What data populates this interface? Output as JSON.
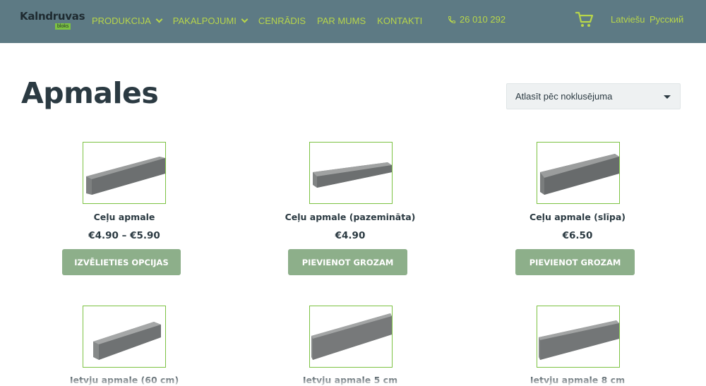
{
  "header": {
    "logo_text": "Kalndruvas",
    "logo_sub": "bloks",
    "nav": [
      {
        "label": "PRODUKCIJA",
        "dropdown": true
      },
      {
        "label": "PAKALPOJUMI",
        "dropdown": true
      },
      {
        "label": "CENRĀDIS",
        "dropdown": false
      },
      {
        "label": "PAR MUMS",
        "dropdown": false
      },
      {
        "label": "KONTAKTI",
        "dropdown": false
      }
    ],
    "phone": "26 010 292",
    "cart_icon": "cart-icon",
    "languages": [
      "Latviešu",
      "Русский"
    ]
  },
  "page": {
    "title": "Apmales",
    "sort_label": "Atlasīt pēc noklusējuma"
  },
  "products": [
    {
      "name": "Ceļu apmale",
      "price": "€4.90 – €5.90",
      "button": "IZVĒLIETIES OPCIJAS"
    },
    {
      "name": "Ceļu apmale (pazemināta)",
      "price": "€4.90",
      "button": "PIEVIENOT GROZAM"
    },
    {
      "name": "Ceļu apmale (slīpa)",
      "price": "€6.50",
      "button": "PIEVIENOT GROZAM"
    },
    {
      "name": "Ietvju apmale (60 cm)"
    },
    {
      "name": "Ietvju apmale 5 cm"
    },
    {
      "name": "Ietvju apmale 8 cm"
    }
  ],
  "colors": {
    "header_bg": "#5d7a84",
    "accent": "#b8d64a",
    "button_bg": "#8daf8a",
    "thumb_border": "#7cc242",
    "title": "#2b3a42"
  }
}
